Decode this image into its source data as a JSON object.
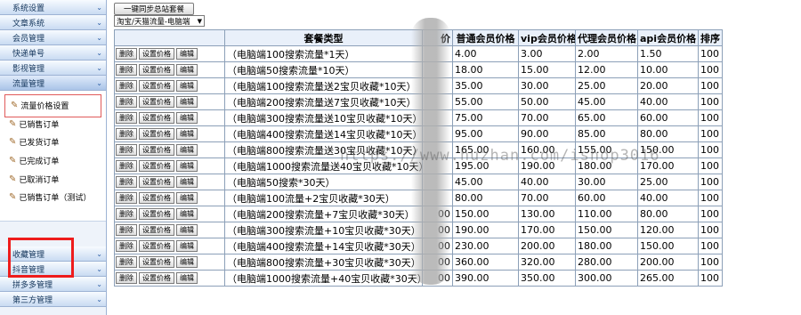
{
  "sidebar": {
    "top_items": [
      {
        "label": "系统设置"
      },
      {
        "label": "文章系统"
      },
      {
        "label": "会员管理"
      },
      {
        "label": "快递单号"
      },
      {
        "label": "影视管理"
      },
      {
        "label": "流量管理"
      }
    ],
    "sub_items": [
      {
        "label": "流量价格设置",
        "icon": "wrench-icon",
        "selected": true
      },
      {
        "label": "已销售订单"
      },
      {
        "label": "已发货订单"
      },
      {
        "label": "已完成订单"
      },
      {
        "label": "已取消订单"
      },
      {
        "label": "已销售订单（测试）"
      }
    ],
    "bottom_items": [
      {
        "label": "收藏管理"
      },
      {
        "label": "抖音管理"
      },
      {
        "label": "拼多多管理"
      },
      {
        "label": "第三方管理"
      }
    ]
  },
  "toolbar": {
    "sync_button": "一键同步总站套餐",
    "type_select": "淘宝/天猫流量-电脑端"
  },
  "table": {
    "headers": [
      "",
      "套餐类型",
      "价",
      "普通会员价格",
      "vip会员价格",
      "代理会员价格",
      "api会员价格",
      "排序"
    ],
    "ops": {
      "delete": "删除",
      "set_price": "设置价格",
      "edit": "编辑"
    },
    "rows": [
      {
        "type": "（电脑端100搜索流量*1天）",
        "base": "",
        "normal": "4.00",
        "vip": "3.00",
        "agent": "2.00",
        "api": "1.50",
        "sort": "100"
      },
      {
        "type": "（电脑端50搜索流量*10天）",
        "base": "",
        "normal": "18.00",
        "vip": "15.00",
        "agent": "12.00",
        "api": "10.00",
        "sort": "100"
      },
      {
        "type": "（电脑端100搜索流量送2宝贝收藏*10天）",
        "base": "",
        "normal": "35.00",
        "vip": "30.00",
        "agent": "25.00",
        "api": "20.00",
        "sort": "100"
      },
      {
        "type": "（电脑端200搜索流量送7宝贝收藏*10天）",
        "base": "",
        "normal": "55.00",
        "vip": "50.00",
        "agent": "45.00",
        "api": "40.00",
        "sort": "100"
      },
      {
        "type": "（电脑端300搜索流量送10宝贝收藏*10天）",
        "base": "",
        "normal": "75.00",
        "vip": "70.00",
        "agent": "65.00",
        "api": "60.00",
        "sort": "100"
      },
      {
        "type": "（电脑端400搜索流量送14宝贝收藏*10天）",
        "base": "",
        "normal": "95.00",
        "vip": "90.00",
        "agent": "85.00",
        "api": "80.00",
        "sort": "100"
      },
      {
        "type": "（电脑端800搜索流量送30宝贝收藏*10天）",
        "base": "",
        "normal": "165.00",
        "vip": "160.00",
        "agent": "155.00",
        "api": "150.00",
        "sort": "100"
      },
      {
        "type": "（电脑端1000搜索流量送40宝贝收藏*10天）",
        "base": "",
        "normal": "195.00",
        "vip": "190.00",
        "agent": "180.00",
        "api": "170.00",
        "sort": "100"
      },
      {
        "type": "（电脑端50搜索*30天）",
        "base": "",
        "normal": "45.00",
        "vip": "40.00",
        "agent": "30.00",
        "api": "25.00",
        "sort": "100"
      },
      {
        "type": "（电脑端100流量+2宝贝收藏*30天）",
        "base": "",
        "normal": "80.00",
        "vip": "70.00",
        "agent": "60.00",
        "api": "40.00",
        "sort": "100"
      },
      {
        "type": "（电脑端200搜索流量+7宝贝收藏*30天）",
        "base": "00",
        "normal": "150.00",
        "vip": "130.00",
        "agent": "110.00",
        "api": "80.00",
        "sort": "100"
      },
      {
        "type": "（电脑端300搜索流量+10宝贝收藏*30天）",
        "base": "00",
        "normal": "190.00",
        "vip": "170.00",
        "agent": "150.00",
        "api": "120.00",
        "sort": "100"
      },
      {
        "type": "（电脑端400搜索流量+14宝贝收藏*30天）",
        "base": "00",
        "normal": "230.00",
        "vip": "200.00",
        "agent": "180.00",
        "api": "150.00",
        "sort": "100"
      },
      {
        "type": "（电脑端800搜索流量+30宝贝收藏*30天）",
        "base": "00",
        "normal": "360.00",
        "vip": "320.00",
        "agent": "280.00",
        "api": "200.00",
        "sort": "100"
      },
      {
        "type": "（电脑端1000搜索流量+40宝贝收藏*30天）",
        "base": "00",
        "normal": "390.00",
        "vip": "350.00",
        "agent": "300.00",
        "api": "265.00",
        "sort": "100"
      }
    ]
  },
  "watermark": "https://www.huzhan.com/ishop3016"
}
